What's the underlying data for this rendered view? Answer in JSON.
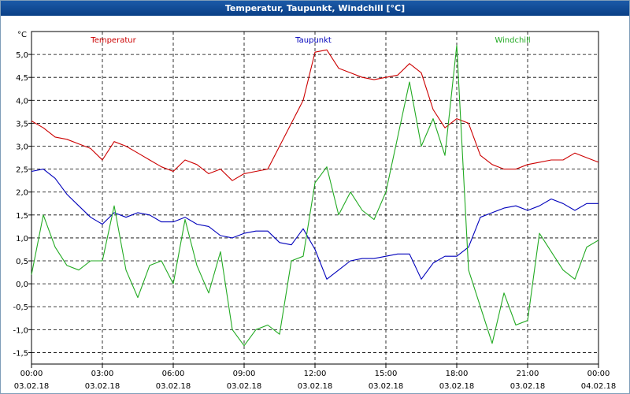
{
  "window": {
    "title": "Temperatur, Taupunkt, Windchill [°C]"
  },
  "chart_data": {
    "type": "line",
    "title": "Temperatur, Taupunkt, Windchill [°C]",
    "ylabel": "°C",
    "ylim": [
      -1.75,
      5.5
    ],
    "xlim": [
      0,
      24
    ],
    "grid": true,
    "y_ticks": [
      "5,0",
      "4,5",
      "4,0",
      "3,5",
      "3,0",
      "2,5",
      "2,0",
      "1,5",
      "1,0",
      "0,5",
      "0,0",
      "-0,5",
      "-1,0",
      "-1,5"
    ],
    "x_ticks": [
      {
        "time": "00:00",
        "date": "03.02.18"
      },
      {
        "time": "03:00",
        "date": "03.02.18"
      },
      {
        "time": "06:00",
        "date": "03.02.18"
      },
      {
        "time": "09:00",
        "date": "03.02.18"
      },
      {
        "time": "12:00",
        "date": "03.02.18"
      },
      {
        "time": "15:00",
        "date": "03.02.18"
      },
      {
        "time": "18:00",
        "date": "03.02.18"
      },
      {
        "time": "21:00",
        "date": "03.02.18"
      },
      {
        "time": "00:00",
        "date": "04.02.18"
      }
    ],
    "x_hours": [
      0,
      0.5,
      1,
      1.5,
      2,
      2.5,
      3,
      3.5,
      4,
      4.5,
      5,
      5.5,
      6,
      6.5,
      7,
      7.5,
      8,
      8.5,
      9,
      9.5,
      10,
      10.5,
      11,
      11.5,
      12,
      12.5,
      13,
      13.5,
      14,
      14.5,
      15,
      15.5,
      16,
      16.5,
      17,
      17.5,
      18,
      18.5,
      19,
      19.5,
      20,
      20.5,
      21,
      21.5,
      22,
      22.5,
      23,
      23.5,
      24
    ],
    "series": [
      {
        "name": "Temperatur",
        "color": "#cc0000",
        "values": [
          3.55,
          3.4,
          3.2,
          3.15,
          3.05,
          2.95,
          2.7,
          3.1,
          3.0,
          2.85,
          2.7,
          2.55,
          2.45,
          2.7,
          2.6,
          2.4,
          2.5,
          2.25,
          2.4,
          2.45,
          2.5,
          3.0,
          3.5,
          4.0,
          5.05,
          5.1,
          4.7,
          4.6,
          4.5,
          4.45,
          4.5,
          4.55,
          4.8,
          4.6,
          3.8,
          3.4,
          3.6,
          3.5,
          2.8,
          2.6,
          2.5,
          2.5,
          2.6,
          2.65,
          2.7,
          2.7,
          2.85,
          2.75,
          2.65
        ]
      },
      {
        "name": "Taupunkt",
        "color": "#0000bb",
        "values": [
          2.45,
          2.5,
          2.3,
          1.95,
          1.7,
          1.45,
          1.3,
          1.55,
          1.45,
          1.55,
          1.5,
          1.35,
          1.35,
          1.45,
          1.3,
          1.25,
          1.05,
          1.0,
          1.1,
          1.15,
          1.15,
          0.9,
          0.85,
          1.2,
          0.75,
          0.1,
          0.3,
          0.5,
          0.55,
          0.55,
          0.6,
          0.65,
          0.65,
          0.1,
          0.45,
          0.6,
          0.6,
          0.8,
          1.45,
          1.55,
          1.65,
          1.7,
          1.6,
          1.7,
          1.85,
          1.75,
          1.6,
          1.75,
          1.75
        ]
      },
      {
        "name": "Windchill",
        "color": "#22aa22",
        "values": [
          0.2,
          1.5,
          0.8,
          0.4,
          0.3,
          0.5,
          0.5,
          1.7,
          0.3,
          -0.3,
          0.4,
          0.5,
          0.0,
          1.4,
          0.4,
          -0.2,
          0.7,
          -1.0,
          -1.35,
          -1.0,
          -0.9,
          -1.1,
          0.5,
          0.6,
          2.2,
          2.55,
          1.5,
          2.0,
          1.6,
          1.4,
          2.0,
          3.2,
          4.4,
          3.0,
          3.6,
          2.8,
          5.2,
          0.3,
          -0.5,
          -1.3,
          -0.2,
          -0.9,
          -0.8,
          1.1,
          0.7,
          0.3,
          0.1,
          0.8,
          0.95
        ]
      }
    ]
  }
}
